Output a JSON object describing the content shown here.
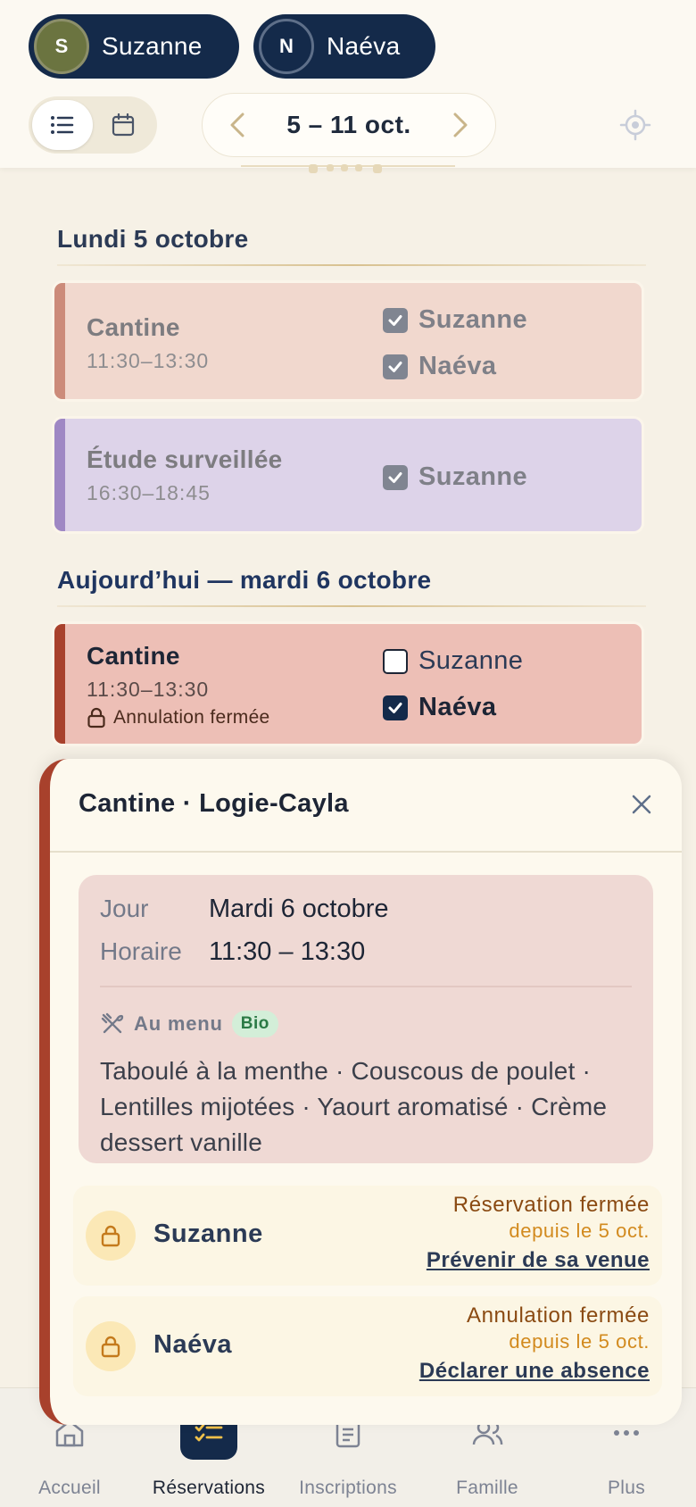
{
  "header": {
    "children": [
      {
        "initial": "S",
        "name": "Suzanne"
      },
      {
        "initial": "N",
        "name": "Naéva"
      }
    ],
    "week_label": "5 – 11 oct."
  },
  "days": [
    {
      "heading": "Lundi 5 octobre",
      "cards": [
        {
          "title": "Cantine",
          "time": "11:30–13:30",
          "children": [
            {
              "name": "Suzanne",
              "checked": true
            },
            {
              "name": "Naéva",
              "checked": true
            }
          ]
        },
        {
          "title": "Étude surveillée",
          "time": "16:30–18:45",
          "children": [
            {
              "name": "Suzanne",
              "checked": true
            }
          ]
        }
      ]
    },
    {
      "heading": "Aujourd’hui — mardi 6 octobre",
      "cards": [
        {
          "title": "Cantine",
          "time": "11:30–13:30",
          "locked_text": "Annulation fermée",
          "children": [
            {
              "name": "Suzanne",
              "checked": false
            },
            {
              "name": "Naéva",
              "checked": true
            }
          ]
        }
      ]
    }
  ],
  "sheet": {
    "title": "Cantine · Logie-Cayla",
    "jour_label": "Jour",
    "jour_value": "Mardi 6 octobre",
    "horaire_label": "Horaire",
    "horaire_value": "11:30 – 13:30",
    "menu_label": "Au menu",
    "menu_badge": "Bio",
    "menu_text": "Taboulé à la menthe · Couscous de poulet · Lentilles mijotées · Yaourt aromatisé · Crème dessert vanille",
    "rows": [
      {
        "name": "Suzanne",
        "status": "Réservation fermée",
        "since": "depuis le 5 oct.",
        "action": "Prévenir de sa venue"
      },
      {
        "name": "Naéva",
        "status": "Annulation fermée",
        "since": "depuis le 5 oct.",
        "action": "Déclarer une absence"
      }
    ]
  },
  "nav": [
    {
      "label": "Accueil",
      "icon": "home-icon"
    },
    {
      "label": "Réservations",
      "icon": "checklist-icon",
      "active": true
    },
    {
      "label": "Inscriptions",
      "icon": "clipboard-icon"
    },
    {
      "label": "Famille",
      "icon": "family-icon"
    },
    {
      "label": "Plus",
      "icon": "more-icon"
    }
  ],
  "colors": {
    "navy": "#142a4a",
    "terracotta": "#a8412c",
    "lunch_past": "#f1d8ce",
    "study_past": "#ddd3e9",
    "lunch_today": "#edbfb6"
  }
}
